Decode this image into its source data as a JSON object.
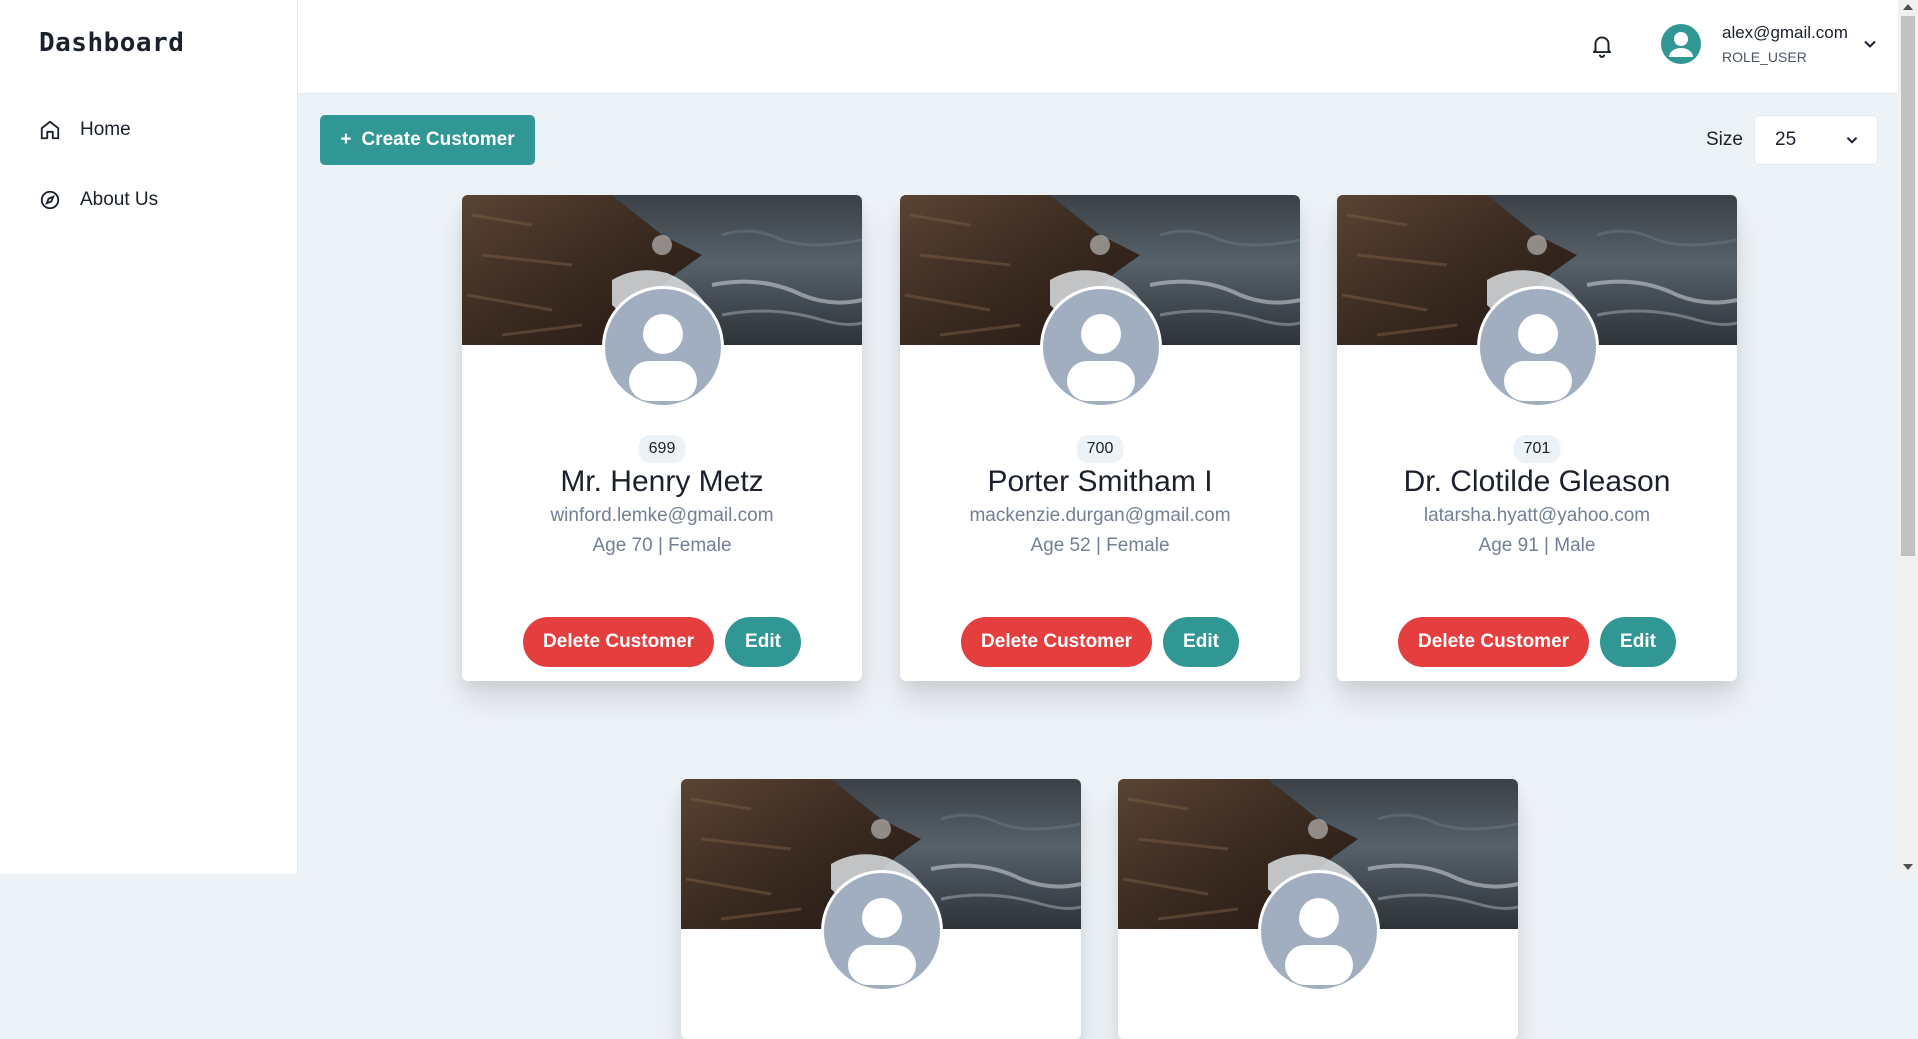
{
  "sidebar": {
    "brand": "Dashboard",
    "items": [
      {
        "label": "Home",
        "icon": "home-icon"
      },
      {
        "label": "About Us",
        "icon": "compass-icon"
      }
    ]
  },
  "header": {
    "user_email": "alex@gmail.com",
    "user_role": "ROLE_USER",
    "icons": [
      "bell-icon",
      "user-avatar-icon",
      "chevron-down-icon"
    ]
  },
  "toolbar": {
    "create_label": "Create Customer",
    "create_icon": "plus-icon",
    "size_label": "Size",
    "size_value": "25"
  },
  "customers": [
    {
      "id": "699",
      "name": "Mr. Henry Metz",
      "email": "winford.lemke@gmail.com",
      "meta": "Age 70 | Female"
    },
    {
      "id": "700",
      "name": "Porter Smitham I",
      "email": "mackenzie.durgan@gmail.com",
      "meta": "Age 52 | Female"
    },
    {
      "id": "701",
      "name": "Dr. Clotilde Gleason",
      "email": "latarsha.hyatt@yahoo.com",
      "meta": "Age 91 | Male"
    }
  ],
  "card_actions": {
    "delete_label": "Delete Customer",
    "edit_label": "Edit"
  },
  "colors": {
    "accent": "#319795",
    "danger": "#e53e3e",
    "background": "#edf2f7",
    "avatar_placeholder": "#a0aec0"
  }
}
